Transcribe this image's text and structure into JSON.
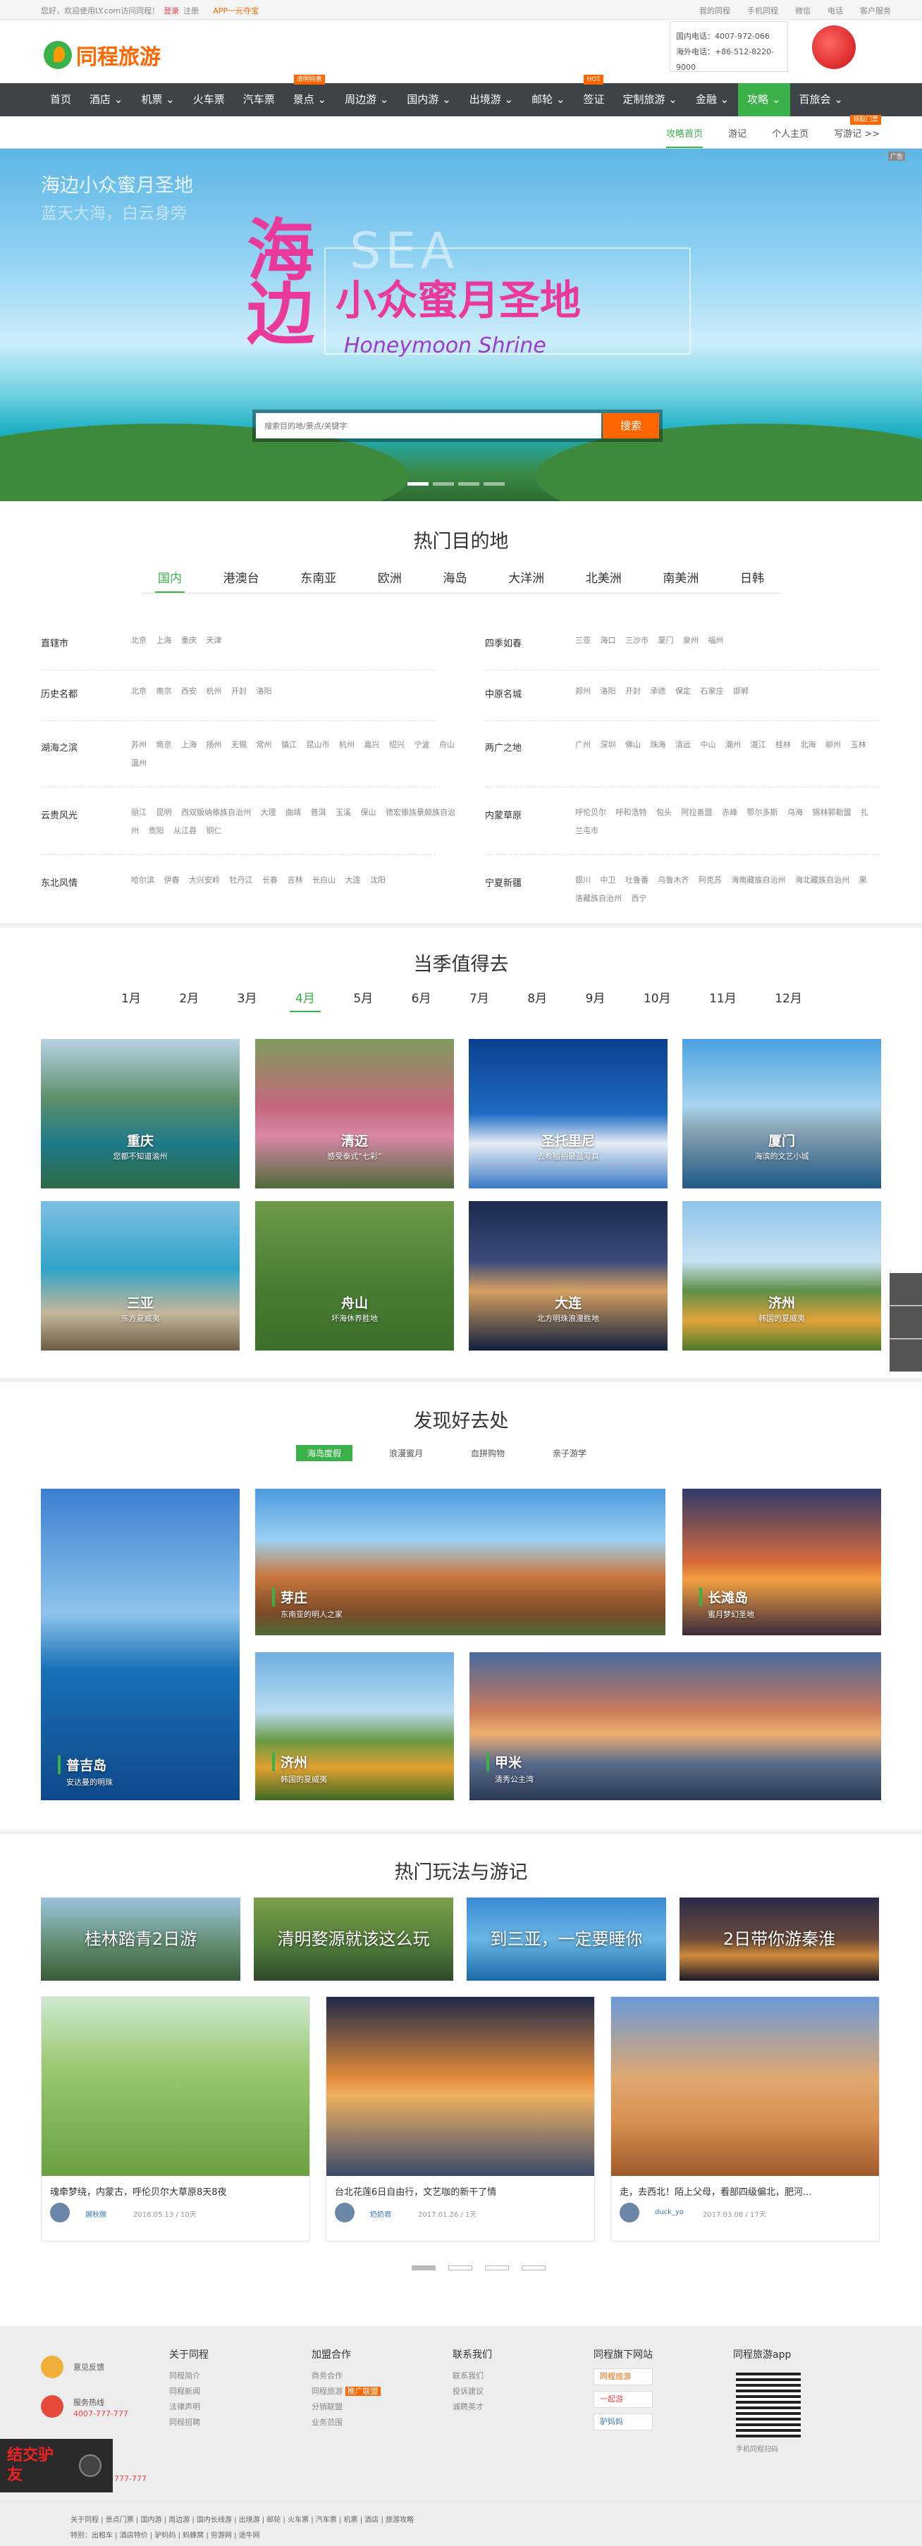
{
  "topbar": {
    "greeting": "您好，欢迎使用LY.com访问同程！",
    "login": "登录",
    "register": "注册",
    "app": "APP一元夺宝",
    "right": [
      "我的同程",
      "手机同程",
      "微信",
      "电话",
      "客户服务"
    ]
  },
  "header": {
    "logo": "同程旅游",
    "phone1": "国内电话：4007-972-066",
    "phone2": "海外电话：+86-512-8220-9000"
  },
  "nav": {
    "items": [
      {
        "label": "首页",
        "badge": ""
      },
      {
        "label": "酒店 ⌄",
        "badge": ""
      },
      {
        "label": "机票 ⌄",
        "badge": ""
      },
      {
        "label": "火车票",
        "badge": ""
      },
      {
        "label": "汽车票",
        "badge": ""
      },
      {
        "label": "景点 ⌄",
        "badge": "清明特惠"
      },
      {
        "label": "周边游 ⌄",
        "badge": ""
      },
      {
        "label": "国内游 ⌄",
        "badge": ""
      },
      {
        "label": "出境游 ⌄",
        "badge": ""
      },
      {
        "label": "邮轮 ⌄",
        "badge": ""
      },
      {
        "label": "签证",
        "badge": "HOT"
      },
      {
        "label": "定制旅游 ⌄",
        "badge": ""
      },
      {
        "label": "金融 ⌄",
        "badge": ""
      },
      {
        "label": "攻略 ⌄",
        "badge": ""
      },
      {
        "label": "百旅会 ⌄",
        "badge": ""
      }
    ]
  },
  "subnav": {
    "items": [
      "攻略首页",
      "游记",
      "个人主页",
      "写游记 >>"
    ],
    "badge": "领取门票"
  },
  "banner": {
    "t1": "海边小众蜜月圣地",
    "t2": "蓝天大海，白云身旁",
    "big1": "海",
    "big2": "边",
    "headline": "小众蜜月圣地",
    "sea": "SEA",
    "english": "Honeymoon Shrine",
    "ad": "广告",
    "search_placeholder": "搜索目的地/景点/关键字",
    "search_btn": "搜索"
  },
  "hot": {
    "title": "热门目的地",
    "tabs": [
      "国内",
      "港澳台",
      "东南亚",
      "欧洲",
      "海岛",
      "大洋洲",
      "北美洲",
      "南美洲",
      "日韩"
    ],
    "groups": [
      {
        "k": "直辖市",
        "v": "北京 上海 重庆 天津"
      },
      {
        "k": "四季如春",
        "v": "三亚 海口 三沙市 厦门 泉州 福州"
      },
      {
        "k": "历史名都",
        "v": "北京 南京 西安 杭州 开封 洛阳"
      },
      {
        "k": "中原名城",
        "v": "郑州 洛阳 开封 承德 保定 石家庄 邯郸"
      },
      {
        "k": "湖海之滨",
        "v": "苏州 南京 上海 扬州 无锡 常州 镇江 昆山市 杭州 嘉兴 绍兴 宁波 舟山 温州"
      },
      {
        "k": "两广之地",
        "v": "广州 深圳 佛山 珠海 清远 中山 潮州 湛江 桂林 北海 柳州 玉林"
      },
      {
        "k": "云贵风光",
        "v": "丽江 昆明 西双版纳傣族自治州 大理 曲靖 普洱 玉溪 保山 德宏傣族景颇族自治州 贵阳 从江县 铜仁"
      },
      {
        "k": "内蒙草原",
        "v": "呼伦贝尔 呼和浩特 包头 阿拉善盟 赤峰 鄂尔多斯 乌海 锡林郭勒盟 扎兰屯市"
      },
      {
        "k": "东北风情",
        "v": "哈尔滨 伊春 大兴安岭 牡丹江 长春 吉林 长白山 大连 沈阳"
      },
      {
        "k": "宁夏新疆",
        "v": "银川 中卫 吐鲁番 乌鲁木齐 阿克苏 海南藏族自治州 海北藏族自治州 果洛藏族自治州 西宁"
      }
    ]
  },
  "season": {
    "title": "当季值得去",
    "months": [
      "1月",
      "2月",
      "3月",
      "4月",
      "5月",
      "6月",
      "7月",
      "8月",
      "9月",
      "10月",
      "11月",
      "12月"
    ],
    "cards": [
      {
        "name": "重庆",
        "desc": "您都不知道渝州"
      },
      {
        "name": "清迈",
        "desc": "感受泰式“七彩”"
      },
      {
        "name": "圣托里尼",
        "desc": "去希腊拍最蓝写真"
      },
      {
        "name": "厦门",
        "desc": "海滨的文艺小城"
      },
      {
        "name": "三亚",
        "desc": "东方夏威夷"
      },
      {
        "name": "舟山",
        "desc": "坏海休养胜地"
      },
      {
        "name": "大连",
        "desc": "北方明珠浪漫胜地"
      },
      {
        "name": "济州",
        "desc": "韩国的夏威夷"
      }
    ]
  },
  "discover": {
    "title": "发现好去处",
    "tabs": [
      "海岛度假",
      "浪漫蜜月",
      "血拼购物",
      "亲子游学"
    ],
    "items": [
      {
        "name": "普吉岛",
        "desc": "安达曼的明珠"
      },
      {
        "name": "芽庄",
        "desc": "东南亚的明人之家"
      },
      {
        "name": "长滩岛",
        "desc": "蜜月梦幻圣地"
      },
      {
        "name": "济州",
        "desc": "韩国的夏威夷"
      },
      {
        "name": "甲米",
        "desc": "清秀公主湾"
      }
    ]
  },
  "play": {
    "title": "热门玩法与游记",
    "cards": [
      "桂林踏青2日游",
      "清明婺源就该这么玩",
      "到三亚，一定要睡你",
      "2日带你游秦淮"
    ],
    "notes": [
      {
        "title": "魂牵梦绕，内蒙古，呼伦贝尔大草原8天8夜",
        "author": "展秋微",
        "date": "2016.05.13 / 10天"
      },
      {
        "title": "台北花莲6日自由行，文艺咖的新干了情",
        "author": "奶奶君",
        "date": "2017.01.26 / 1天"
      },
      {
        "title": "走，去西北！陌上父母，看部四级偏北，肥河...",
        "author": "duck_yo",
        "date": "2017.03.08 / 17天"
      }
    ]
  },
  "footer": {
    "feedback": "意见反馈",
    "hotline_label": "服务热线",
    "hotline": "4007-777-777",
    "hotline2": "777-777",
    "cols": [
      {
        "title": "关于同程",
        "items": [
          "同程简介",
          "同程新闻",
          "法律声明",
          "同程招聘"
        ]
      },
      {
        "title": "加盟合作",
        "items": [
          "商务合作",
          "同程旅游",
          "分销联盟",
          "业务范围"
        ],
        "tag": "推广联盟"
      },
      {
        "title": "联系我们",
        "items": [
          "联系我们",
          "投诉建议",
          "诚聘英才"
        ]
      },
      {
        "title": "同程旗下网站",
        "items": [
          "同程旅游",
          "一起游",
          "驴妈妈"
        ]
      },
      {
        "title": "同程旅游app",
        "items": [
          "手机同程扫码"
        ]
      }
    ],
    "bottom1": "关于同程 | 景点门票 | 国内游 | 周边游 | 国内长线游 | 出境游 | 邮轮 | 火车票 | 汽车票 | 机票 | 酒店 | 旅游攻略",
    "bottom2": "特别：出租车 | 酒店特价 | 驴妈妈 | 蚂蜂窝 | 穷游网 | 途牛网",
    "badge": "结交驴友"
  },
  "colors": {
    "brand": "#3bb14a",
    "accent": "#ff6600",
    "nav": "#3d4347"
  }
}
